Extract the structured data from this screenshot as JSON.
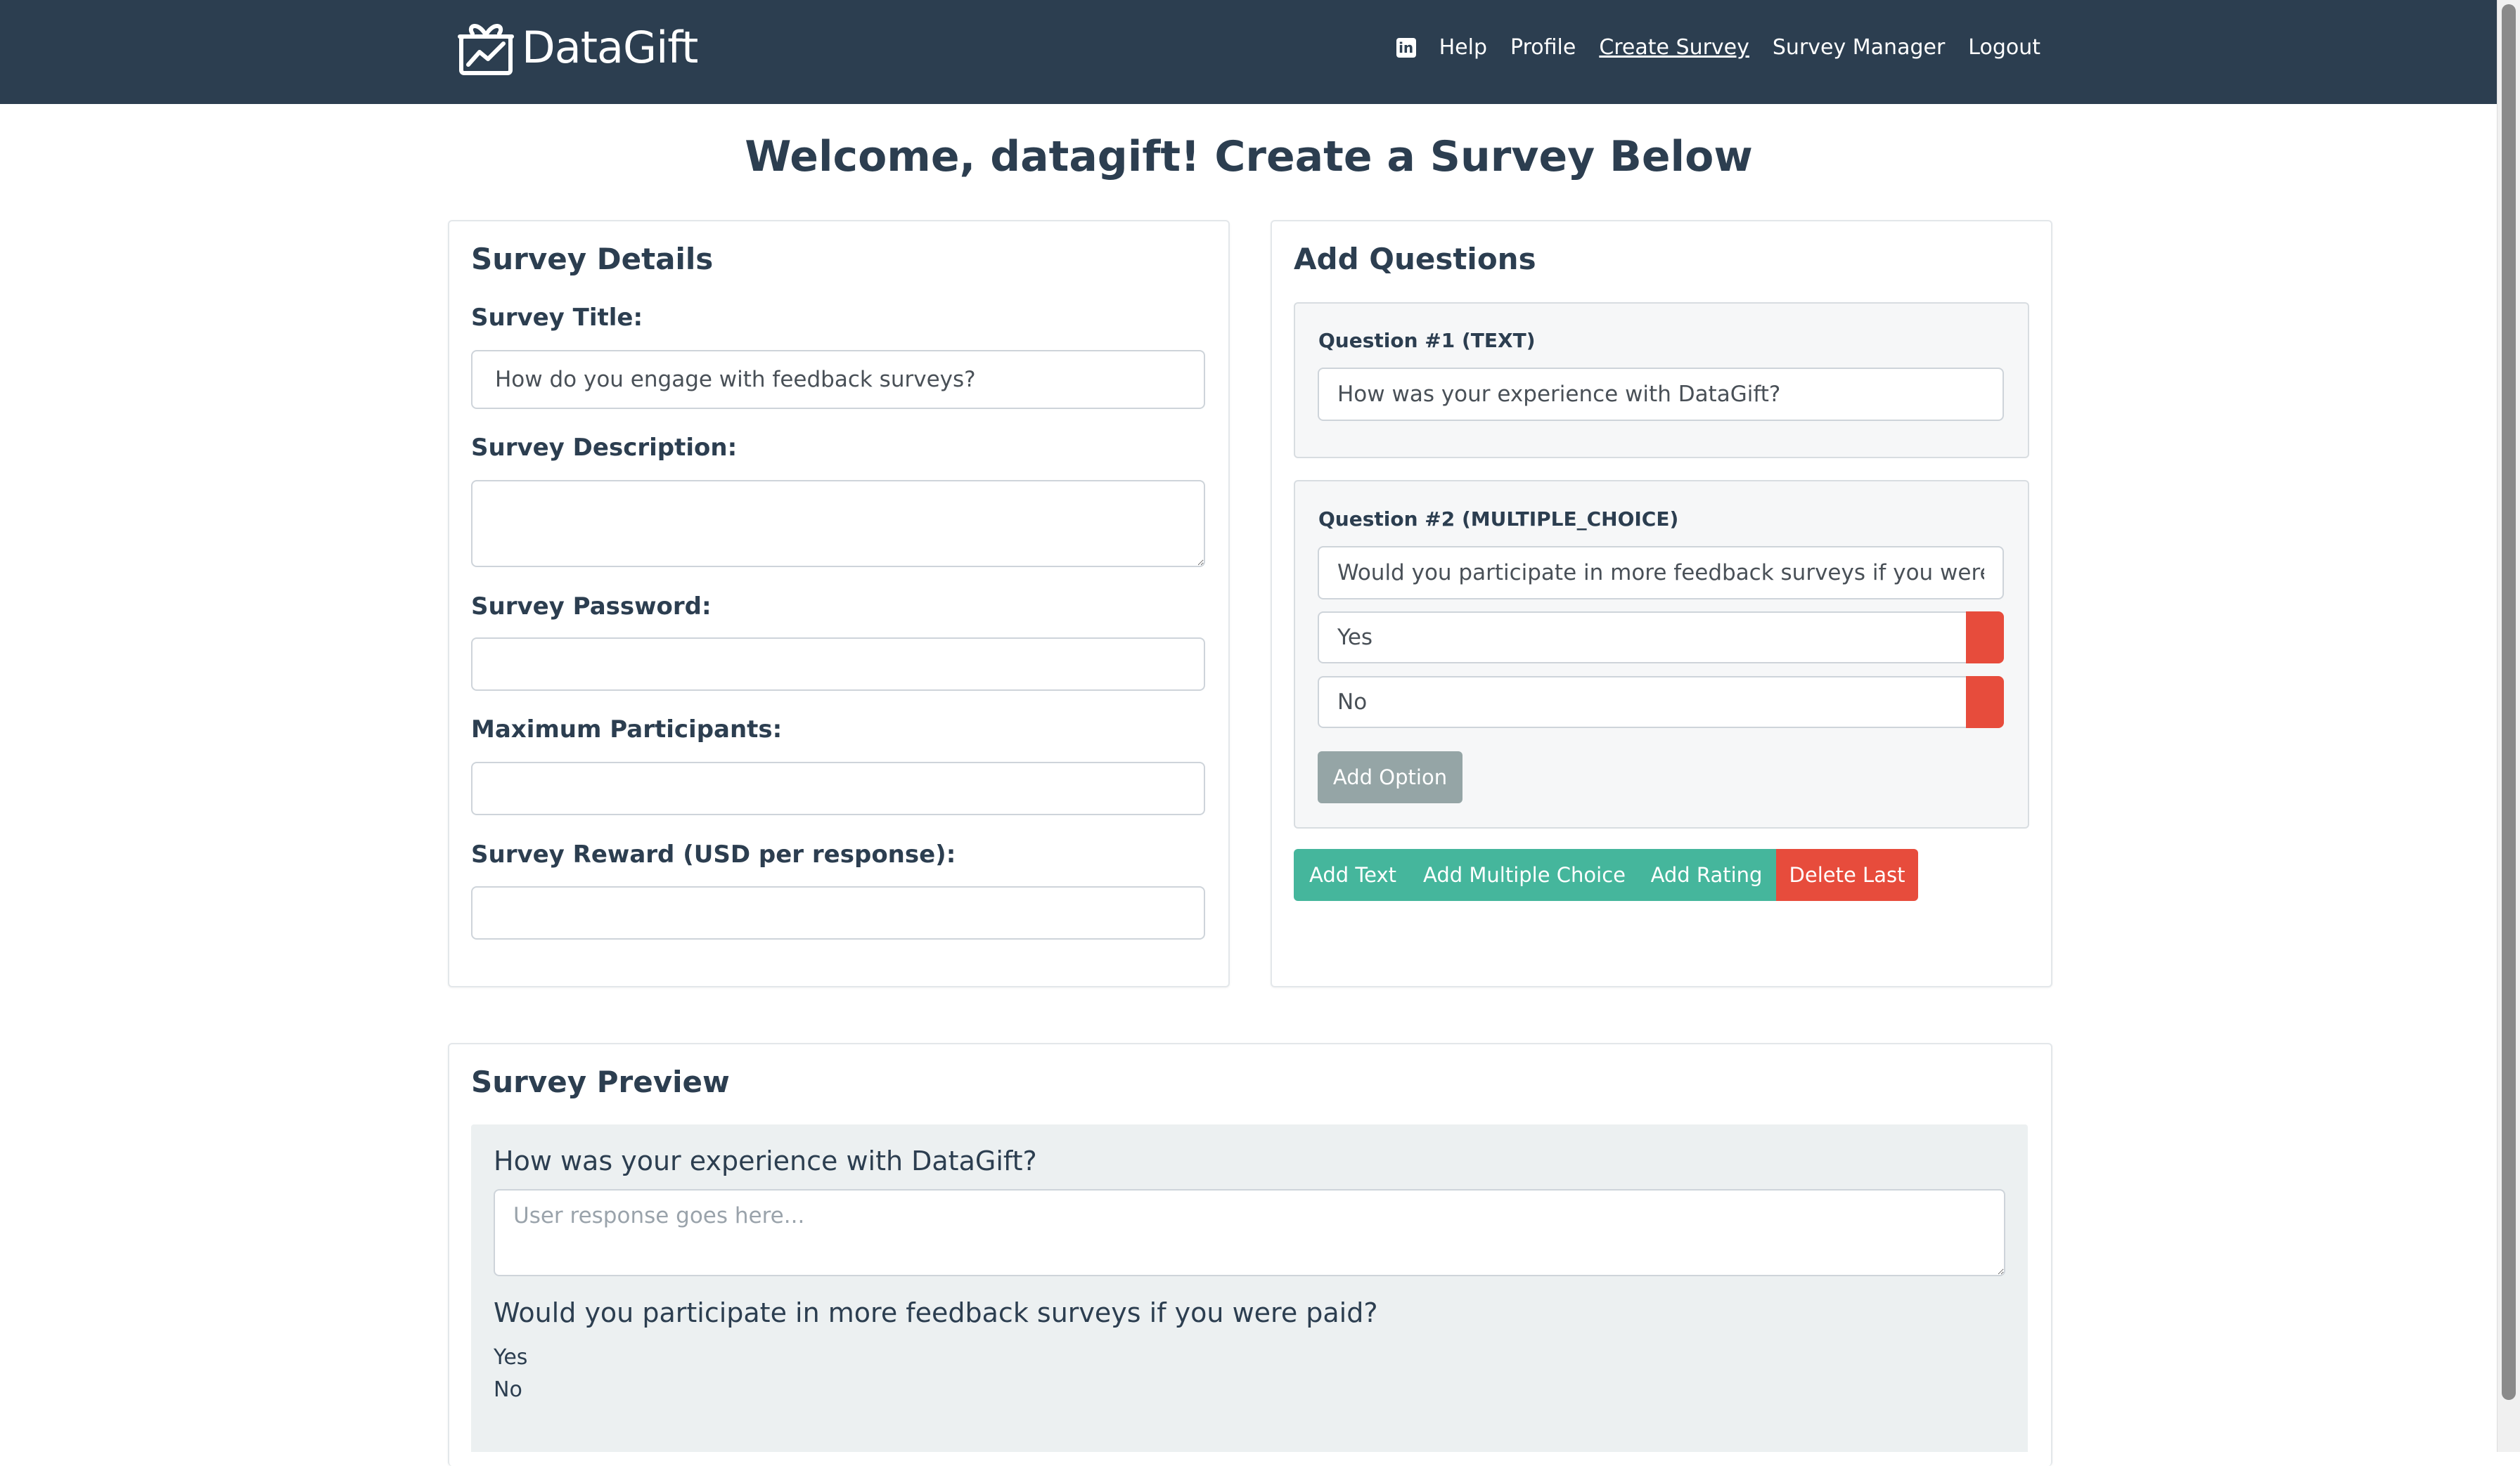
{
  "brand": {
    "name": "DataGift"
  },
  "nav": {
    "linkedin_icon": "linkedin-icon",
    "items": [
      {
        "label": "Help"
      },
      {
        "label": "Profile"
      },
      {
        "label": "Create Survey",
        "active": true
      },
      {
        "label": "Survey Manager"
      },
      {
        "label": "Logout"
      }
    ]
  },
  "page_title": "Welcome, datagift! Create a Survey Below",
  "details": {
    "heading": "Survey Details",
    "title_label": "Survey Title:",
    "title_value": "How do you engage with feedback surveys?",
    "description_label": "Survey Description:",
    "description_value": "",
    "password_label": "Survey Password:",
    "password_value": "",
    "max_participants_label": "Maximum Participants:",
    "max_participants_value": "",
    "reward_label": "Survey Reward (USD per response):",
    "reward_value": ""
  },
  "questions": {
    "heading": "Add Questions",
    "q1": {
      "label": "Question #1 (TEXT)",
      "value": "How was your experience with DataGift?"
    },
    "q2": {
      "label": "Question #2 (MULTIPLE_CHOICE)",
      "value": "Would you participate in more feedback surveys if you were paid?",
      "options": [
        "Yes",
        "No"
      ],
      "add_option_label": "Add Option"
    },
    "buttons": {
      "add_text": "Add Text",
      "add_multiple_choice": "Add Multiple Choice",
      "add_rating": "Add Rating",
      "delete_last": "Delete Last"
    }
  },
  "preview": {
    "heading": "Survey Preview",
    "q1_text": "How was your experience with DataGift?",
    "q1_placeholder": "User response goes here...",
    "q2_text": "Would you participate in more feedback surveys if you were paid?",
    "q2_options": [
      "Yes",
      "No"
    ]
  },
  "colors": {
    "navbar": "#2c3e50",
    "success": "#45b69c",
    "danger": "#e74c3c",
    "secondary": "#95a5a6",
    "preview_bg": "#ecf0f1"
  }
}
